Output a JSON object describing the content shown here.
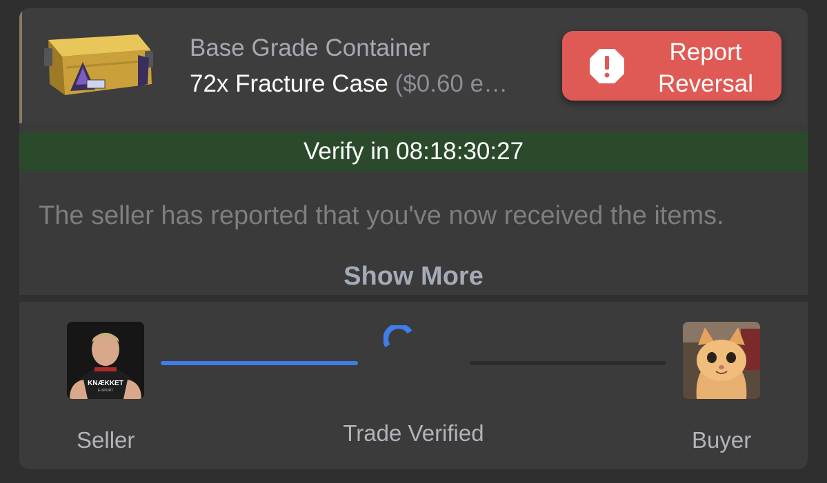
{
  "item": {
    "category": "Base Grade Container",
    "name": "72x Fracture Case",
    "price_suffix": "($0.60 e…"
  },
  "actions": {
    "report_line1": "Report",
    "report_line2": "Reversal"
  },
  "verify": {
    "text": "Verify in 08:18:30:27",
    "color": "#2b4a2c"
  },
  "message": {
    "text": "The seller has reported that you've now received the items.",
    "show_more": "Show More"
  },
  "status": {
    "seller_label": "Seller",
    "middle_label": "Trade Verified",
    "buyer_label": "Buyer",
    "progress_color": "#3f7de8",
    "avatar_seller_text": "KNÆKKET",
    "avatar_seller_subtext": "E-SPORT"
  },
  "colors": {
    "report": "#df5a55",
    "accent": "#3f7de8"
  },
  "icons": [
    "case-image",
    "alert-octagon-icon",
    "spinner-icon",
    "seller-avatar",
    "buyer-avatar"
  ]
}
